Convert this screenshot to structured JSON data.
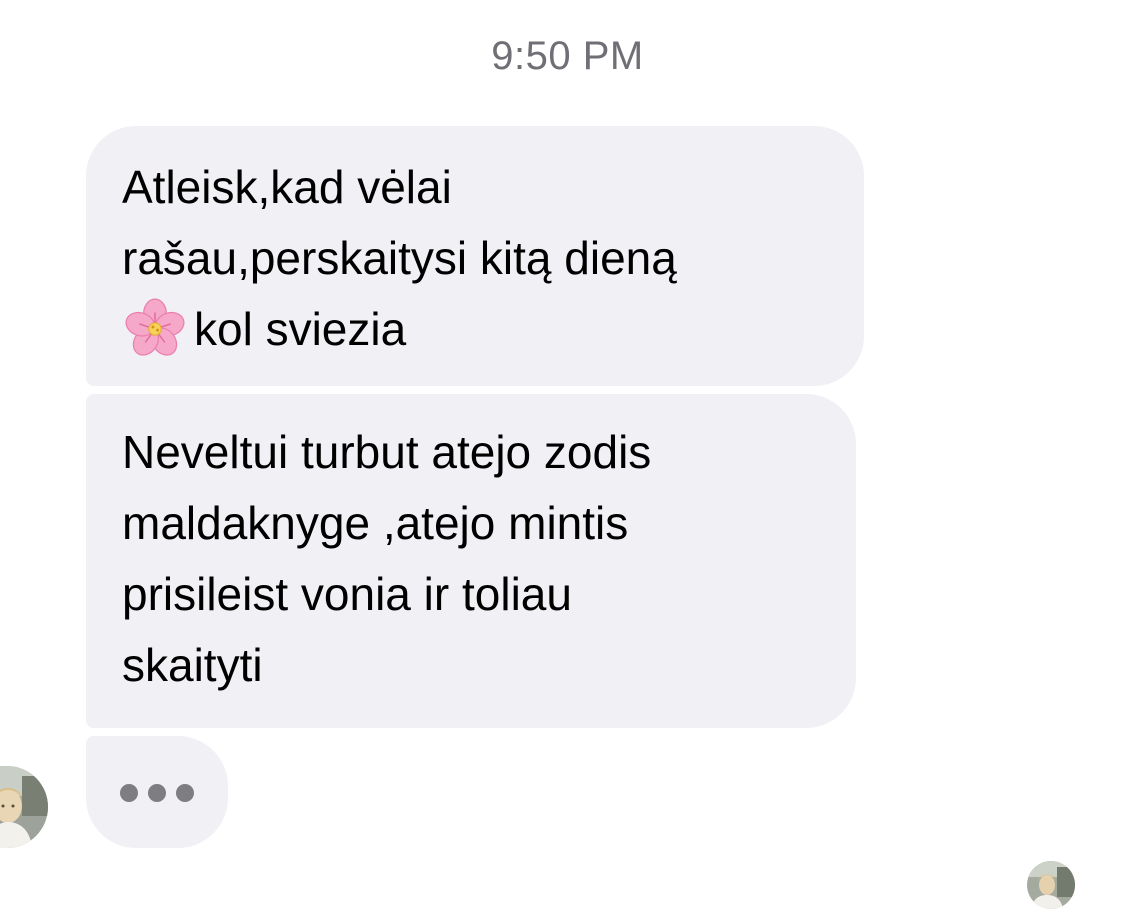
{
  "header": {
    "timestamp": "9:50 PM"
  },
  "messages": [
    {
      "lines": [
        "Atleisk,kad vėlai",
        "rašau,perskaitysi kitą dieną"
      ],
      "emoji_line": {
        "emoji": "cherry-blossom",
        "text": "kol sviezia"
      }
    },
    {
      "lines": [
        "Neveltui turbut atejo zodis",
        "maldaknyge ,atejo mintis",
        "prisileist vonia ir toliau",
        "skaityti"
      ]
    }
  ],
  "typing_indicator": {
    "icon": "ellipsis-icon",
    "dot_color": "#7d7d82"
  },
  "colors": {
    "bubble_background": "#f0f0f5",
    "timestamp_text": "#6f6f75",
    "message_text": "#000000"
  }
}
